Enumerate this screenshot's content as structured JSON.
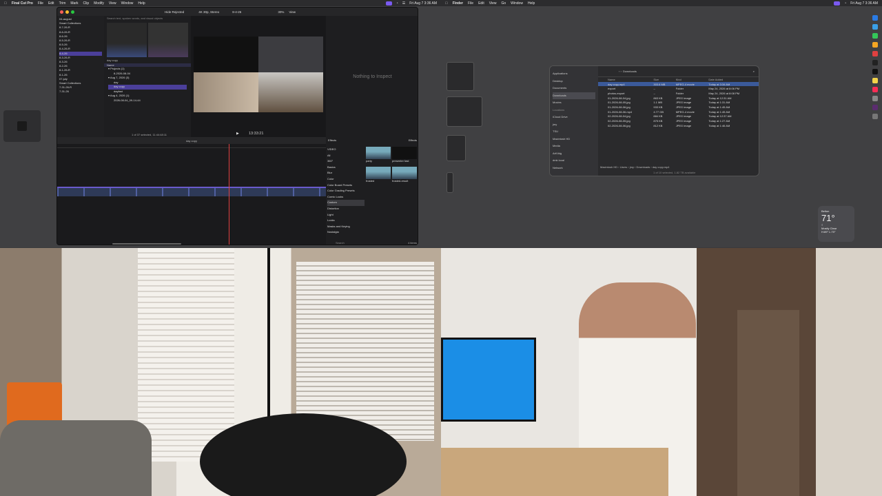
{
  "left_screen": {
    "menubar": {
      "apple": "",
      "app_name": "Final Cut Pro",
      "menus": [
        "File",
        "Edit",
        "Trim",
        "Mark",
        "Clip",
        "Modify",
        "View",
        "Window",
        "Help"
      ],
      "clock": "Fri Aug 7  3:36 AM"
    },
    "fcp": {
      "hide_rejected": "Hide Rejected",
      "format": "4K 30p, Stereo",
      "viewer_title": "8-4-26",
      "zoom": "30%",
      "view_menu": "View",
      "search_placeholder": "Search text, spoken words, and visual objects",
      "library_items": [
        "04-august",
        "Smart Collections",
        "8-7-26-R",
        "8-6-26-R",
        "8-6-26",
        "8-5-26-R",
        "8-5-26",
        "8-4-26-R",
        "8-4-26",
        "8-3-26-R",
        "8-3-26",
        "8-2-26",
        "8-1-26-R",
        "8-1-26",
        "07-july",
        "Smart Collections",
        "7-31-26-R",
        "7-31-26"
      ],
      "browser": {
        "day_label": "day copy",
        "name_header": "Name",
        "projects": "Projects",
        "projects_count": "(1)",
        "project_item": "8-2026-08-04",
        "aug7": "Aug 7, 2026",
        "aug7_count": "(3)",
        "aug7_items": [
          "day",
          "day copy",
          "dayfast"
        ],
        "aug4": "Aug 4, 2026",
        "aug4_count": "(1)",
        "aug4_item": "2026-08-04_09-14-44",
        "selection": "1 of 37 selected, 11:44:48:11"
      },
      "inspector_empty": "Nothing to Inspect",
      "timecode": "13:33:21",
      "timeline_title": "day copy",
      "effects": {
        "title": "Effects",
        "tab": "Effects",
        "categories": [
          "VIDEO",
          "All",
          "360°",
          "Basics",
          "Blur",
          "Color",
          "Color Board Presets",
          "Color Grading Presets",
          "Comic Looks",
          "Custom",
          "Distortion",
          "Light",
          "Looks",
          "Masks and Keying",
          "Nostalgia"
        ],
        "selected_category": "Custom",
        "thumbs": [
          "party",
          "presenter fast",
          "frosted",
          "frosted-result"
        ],
        "search_placeholder": "Search",
        "count": "4 items"
      }
    }
  },
  "right_screen": {
    "menubar": {
      "apple": "",
      "app_name": "Finder",
      "menus": [
        "File",
        "Edit",
        "View",
        "Go",
        "Window",
        "Help"
      ],
      "clock": "Fri Aug 7  3:36 AM"
    },
    "finder": {
      "window_title": "Downloads",
      "sidebar": {
        "favorites": [
          "Applications",
          "Desktop",
          "Documents",
          "Downloads",
          "Movies"
        ],
        "locations_header": "Locations",
        "locations": [
          "iCloud Drive",
          "jmy",
          "TSU",
          "Macintosh HD",
          "Media",
          "ArtVidg",
          "dmk local",
          "Network"
        ]
      },
      "columns": [
        "Name",
        "Size",
        "Kind",
        "Date Added"
      ],
      "files": [
        {
          "name": "day copy.mp4",
          "size": "303.6 MB",
          "kind": "MPEG-4 movie",
          "date": "Today at 3:34 AM"
        },
        {
          "name": "export",
          "size": "--",
          "kind": "Folder",
          "date": "May 24, 2026 at 8:06 PM"
        },
        {
          "name": "photos-export",
          "size": "--",
          "kind": "Folder",
          "date": "May 24, 2026 at 8:08 PM"
        },
        {
          "name": "01-2026-08-04.jpg",
          "size": "863 KB",
          "kind": "JPEG image",
          "date": "Today at 12:31 AM"
        },
        {
          "name": "01-2026-08-05.jpg",
          "size": "1.1 MB",
          "kind": "JPEG image",
          "date": "Today at 1:31 AM"
        },
        {
          "name": "01-2026-08-06.jpg",
          "size": "933 KB",
          "kind": "JPEG image",
          "date": "Today at 1:45 AM"
        },
        {
          "name": "01-2026-08-06.mp4",
          "size": "4.77 GB",
          "kind": "MPEG-4 movie",
          "date": "Today at 1:45 AM"
        },
        {
          "name": "02-2026-08-04.jpg",
          "size": "884 KB",
          "kind": "JPEG image",
          "date": "Today at 12:37 AM"
        },
        {
          "name": "02-2026-08-05.jpg",
          "size": "875 KB",
          "kind": "JPEG image",
          "date": "Today at 1:27 AM"
        },
        {
          "name": "02-2026-08-06.jpg",
          "size": "812 KB",
          "kind": "JPEG image",
          "date": "Today at 1:46 AM"
        }
      ],
      "path": [
        "Macintosh HD",
        "Users",
        "jmy",
        "Downloads",
        "day copy.mp4"
      ],
      "status": "1 of 10 selected, 1.82 TB available"
    },
    "weather": {
      "city": "Belton",
      "temp": "71°",
      "condition": "Mostly Clear",
      "range": "H:89° L:70°"
    }
  },
  "colors": {
    "accent": "#3b5a9a",
    "timeline_clip": "#5060a0",
    "playhead": "#e04040",
    "desktop": "#404042"
  }
}
